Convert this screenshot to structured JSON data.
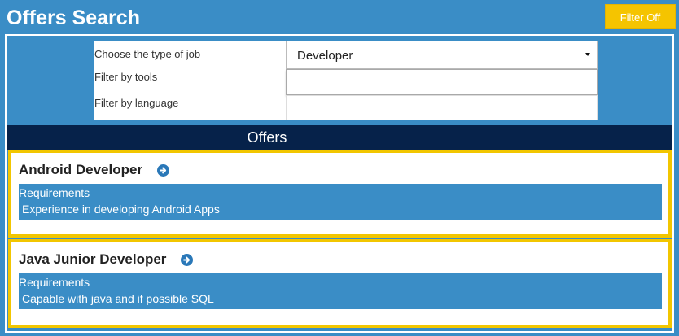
{
  "header": {
    "title": "Offers Search",
    "filter_button_label": "Filter Off"
  },
  "filters": {
    "job_type_label": "Choose the type of job",
    "job_type_value": "Developer",
    "tools_label": "Filter by tools",
    "tools_value": "",
    "language_label": "Filter by language",
    "language_value": ""
  },
  "offers": {
    "section_title": "Offers",
    "items": [
      {
        "title": "Android Developer",
        "requirements_label": "Requirements",
        "requirements_text": "Experience in developing Android Apps"
      },
      {
        "title": "Java Junior Developer",
        "requirements_label": "Requirements",
        "requirements_text": "Capable with java and if possible SQL"
      }
    ]
  },
  "colors": {
    "background": "#3a8dc6",
    "accent_yellow": "#f2c600",
    "offers_bar": "#06224a",
    "arrow_icon": "#2a78b8"
  }
}
